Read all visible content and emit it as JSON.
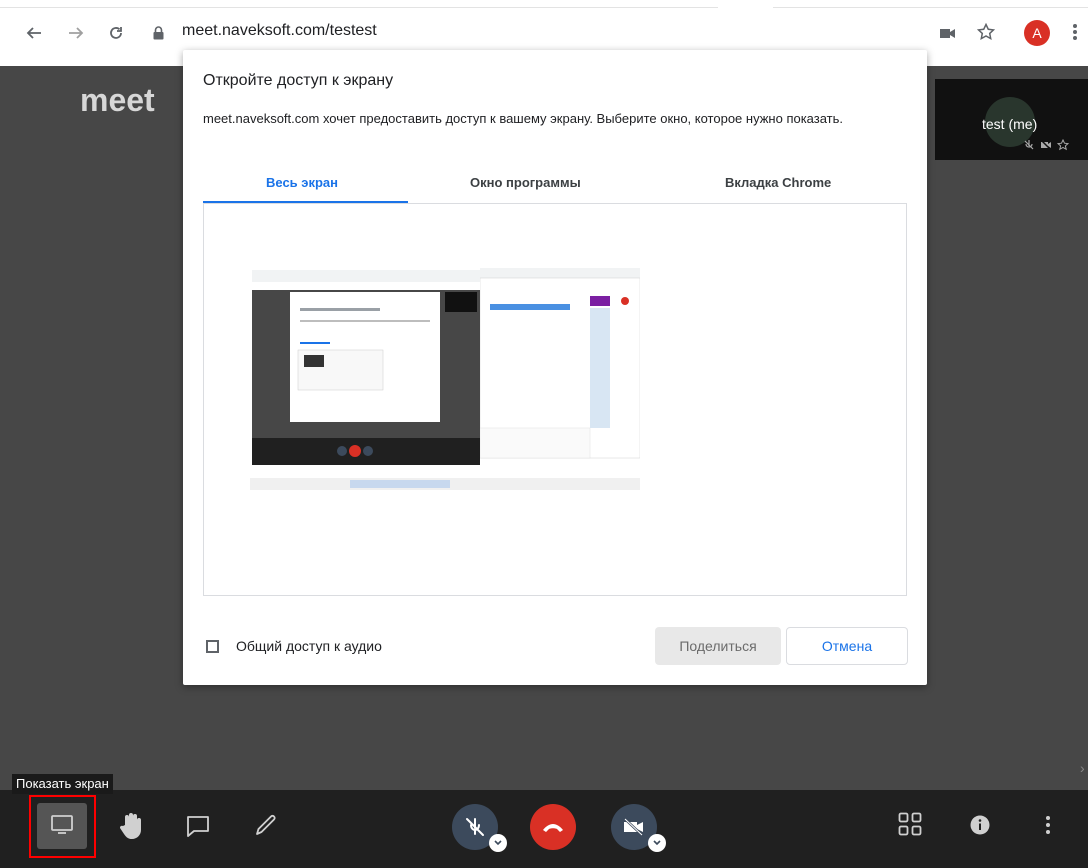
{
  "browser": {
    "url": "meet.naveksoft.com/testest",
    "avatar_letter": "A"
  },
  "meet": {
    "logo": "meet",
    "participant_name": "test (me)"
  },
  "dialog": {
    "title": "Откройте доступ к экрану",
    "description": "meet.naveksoft.com хочет предоставить доступ к вашему экрану. Выберите окно, которое нужно показать.",
    "tabs": [
      {
        "label": "Весь экран",
        "active": true
      },
      {
        "label": "Окно программы",
        "active": false
      },
      {
        "label": "Вкладка Chrome",
        "active": false
      }
    ],
    "audio_checkbox_label": "Общий доступ к аудио",
    "audio_checked": false,
    "share_button": "Поделиться",
    "cancel_button": "Отмена"
  },
  "toolbar": {
    "tooltip": "Показать экран"
  },
  "colors": {
    "accent": "#1a73e8",
    "hangup": "#d93025",
    "highlight": "#ff0000",
    "meet_bg": "#474747",
    "toolbar_bg": "#202020"
  },
  "icons": {
    "back": "arrow-left-icon",
    "forward": "arrow-right-icon",
    "reload": "reload-icon",
    "lock": "lock-icon",
    "camera": "camera-icon",
    "star": "star-icon",
    "menu": "kebab-menu-icon",
    "share_screen": "monitor-icon",
    "raise_hand": "hand-icon",
    "chat": "chat-icon",
    "whiteboard": "pencil-icon",
    "mic_off": "mic-off-icon",
    "hangup": "hangup-icon",
    "video_off": "video-off-icon",
    "grid": "grid-icon",
    "info": "info-icon",
    "more": "more-vert-icon"
  }
}
